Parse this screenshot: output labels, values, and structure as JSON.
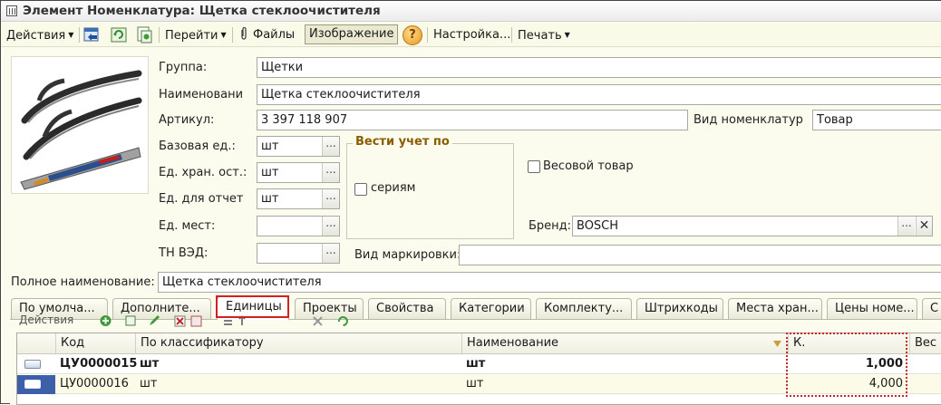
{
  "window": {
    "title": "Элемент Номенклатура: Щетка стеклоочистителя"
  },
  "toolbar": {
    "actions": "Действия",
    "goto": "Перейти",
    "files": "Файлы",
    "image": "Изображение",
    "help": "?",
    "settings": "Настройка...",
    "print": "Печать"
  },
  "form": {
    "group_label": "Группа:",
    "group_value": "Щетки",
    "name_label": "Наименовани",
    "name_value": "Щетка стеклоочистителя",
    "article_label": "Артикул:",
    "article_value": "3 397 118 907",
    "type_label": "Вид номенклатур",
    "type_value": "Товар",
    "base_unit_label": "Базовая ед.:",
    "base_unit_value": "шт",
    "storage_unit_label": "Ед. хран. ост.:",
    "storage_unit_value": "шт",
    "report_unit_label": "Ед. для отчет",
    "report_unit_value": "шт",
    "places_unit_label": "Ед. мест:",
    "places_unit_value": "",
    "tnved_label": "ТН ВЭД:",
    "tnved_value": "",
    "accounting_title": "Вести учет по",
    "series_label": "сериям",
    "weight_label": "Весовой товар",
    "brand_label": "Бренд:",
    "brand_value": "BOSCH",
    "marking_label": "Вид маркировки:",
    "marking_value": "",
    "full_name_label": "Полное наименование:",
    "full_name_value": "Щетка стеклоочистителя"
  },
  "tabs": [
    "По умолча...",
    "Дополните...",
    "Единицы",
    "Проекты",
    "Свойства",
    "Категории",
    "Комплекту...",
    "Штрихкоды",
    "Места хран...",
    "Цены номе...",
    "С"
  ],
  "units_toolbar": {
    "actions": "Действия"
  },
  "grid": {
    "columns": [
      "Код",
      "По классификатору",
      "Наименование",
      "К.",
      "Вес ("
    ],
    "rows": [
      {
        "code": "ЦУ0000015",
        "classifier": "шт",
        "name": "шт",
        "k": "1,000",
        "bold": true
      },
      {
        "code": "ЦУ0000016",
        "classifier": "шт",
        "name": "шт",
        "k": "4,000",
        "bold": false
      }
    ]
  },
  "colors": {
    "highlight": "#d32020",
    "panel_bg": "#fbfbee"
  }
}
